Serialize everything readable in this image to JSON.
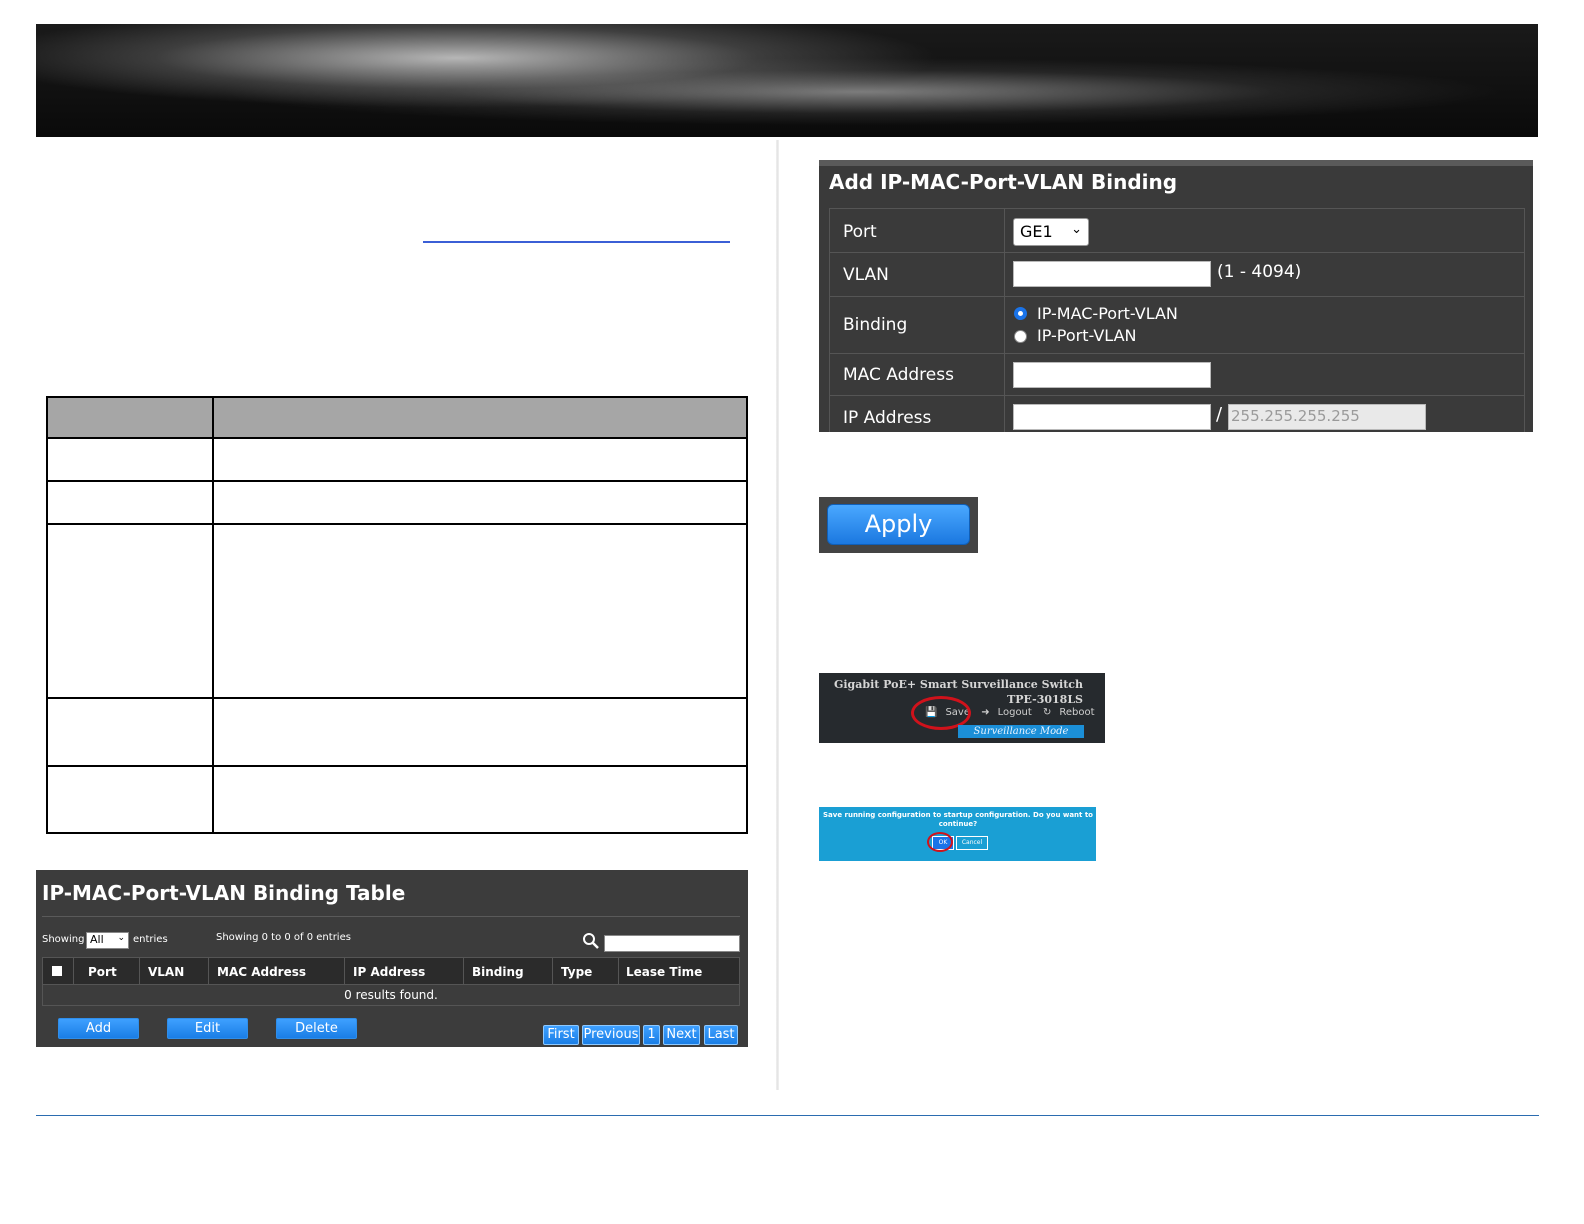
{
  "add_panel": {
    "title": "Add IP-MAC-Port-VLAN Binding",
    "port_label": "Port",
    "port_value": "GE1",
    "vlan_label": "VLAN",
    "vlan_value": "",
    "vlan_range": "(1 - 4094)",
    "binding_label": "Binding",
    "binding_options": [
      "IP-MAC-Port-VLAN",
      "IP-Port-VLAN"
    ],
    "binding_selected": "IP-MAC-Port-VLAN",
    "mac_label": "MAC Address",
    "mac_value": "",
    "ip_label": "IP Address",
    "ip_value": "",
    "ip_separator": "/",
    "mask_placeholder": "255.255.255.255"
  },
  "apply_button": {
    "label": "Apply"
  },
  "header_thumb": {
    "product_line": "Gigabit PoE+ Smart Surveillance Switch",
    "model": "TPE-3018LS",
    "save_label": "Save",
    "logout_label": "Logout",
    "reboot_label": "Reboot",
    "mode_label": "Surveillance Mode"
  },
  "confirm_thumb": {
    "message": "Save running configuration to startup configuration. Do you want to continue?",
    "ok_label": "OK",
    "cancel_label": "Cancel"
  },
  "binding_table": {
    "title": "IP-MAC-Port-VLAN Binding Table",
    "showing_label": "Showing",
    "page_size": "All",
    "entries_label": "entries",
    "count_text": "Showing 0 to 0 of 0 entries",
    "search_value": "",
    "columns": [
      "Port",
      "VLAN",
      "MAC Address",
      "IP Address",
      "Binding",
      "Type",
      "Lease Time"
    ],
    "empty_text": "0 results found.",
    "buttons": {
      "add": "Add",
      "edit": "Edit",
      "delete": "Delete"
    },
    "pagination": {
      "first": "First",
      "previous": "Previous",
      "page": "1",
      "next": "Next",
      "last": "Last"
    }
  },
  "colors": {
    "accent_blue": "#1a7ee6",
    "panel_dark": "#3a3a3a",
    "highlight_red": "#d0121b",
    "rule_blue": "#2b6cb0"
  }
}
